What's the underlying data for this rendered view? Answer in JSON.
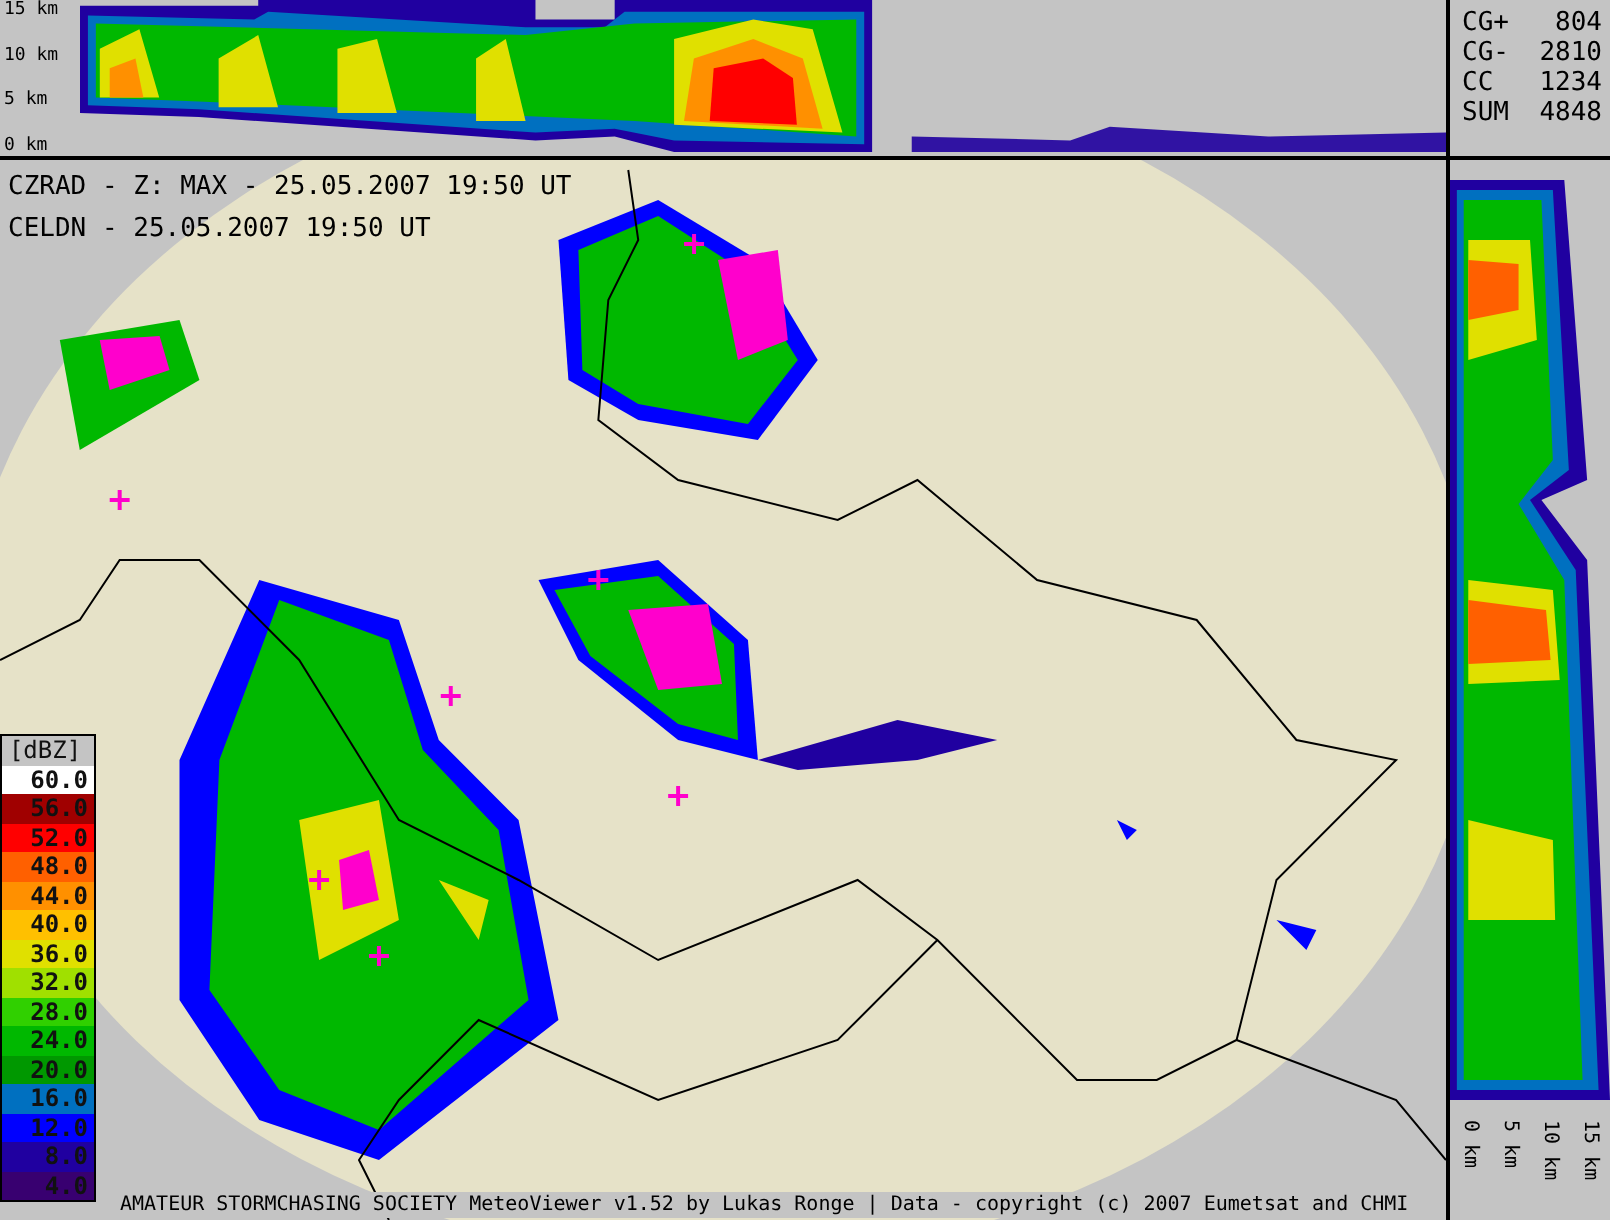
{
  "top_section": {
    "axis_labels": [
      "15 km",
      "10 km",
      "5 km",
      "0 km"
    ]
  },
  "lightning_stats": [
    {
      "label": "CG+",
      "value": "804"
    },
    {
      "label": "CG-",
      "value": "2810"
    },
    {
      "label": "CC",
      "value": "1234"
    },
    {
      "label": "SUM",
      "value": "4848"
    }
  ],
  "map": {
    "title_lines": [
      "CZRAD - Z: MAX - 25.05.2007 19:50 UT",
      "CELDN - 25.05.2007 19:50 UT"
    ],
    "legend": {
      "unit": "[dBZ]",
      "items": [
        {
          "value": "60.0",
          "color": "#ffffff"
        },
        {
          "value": "56.0",
          "color": "#a00000"
        },
        {
          "value": "52.0",
          "color": "#ff0000"
        },
        {
          "value": "48.0",
          "color": "#ff6000"
        },
        {
          "value": "44.0",
          "color": "#ff9000"
        },
        {
          "value": "40.0",
          "color": "#ffc000"
        },
        {
          "value": "36.0",
          "color": "#e0e000"
        },
        {
          "value": "32.0",
          "color": "#a0e000"
        },
        {
          "value": "28.0",
          "color": "#30d000"
        },
        {
          "value": "24.0",
          "color": "#00b800"
        },
        {
          "value": "20.0",
          "color": "#009800"
        },
        {
          "value": "16.0",
          "color": "#0070c0"
        },
        {
          "value": "12.0",
          "color": "#0000ff"
        },
        {
          "value": "8.0",
          "color": "#2000a0"
        },
        {
          "value": "4.0",
          "color": "#380070"
        }
      ]
    }
  },
  "side_section": {
    "axis_labels": [
      "0 km",
      "5 km",
      "10 km",
      "15 km"
    ]
  },
  "footer": "AMATEUR STORMCHASING SOCIETY MeteoViewer v1.52 by Lukas Ronge | Data - copyright (c) 2007 Eumetsat and CHMI"
}
